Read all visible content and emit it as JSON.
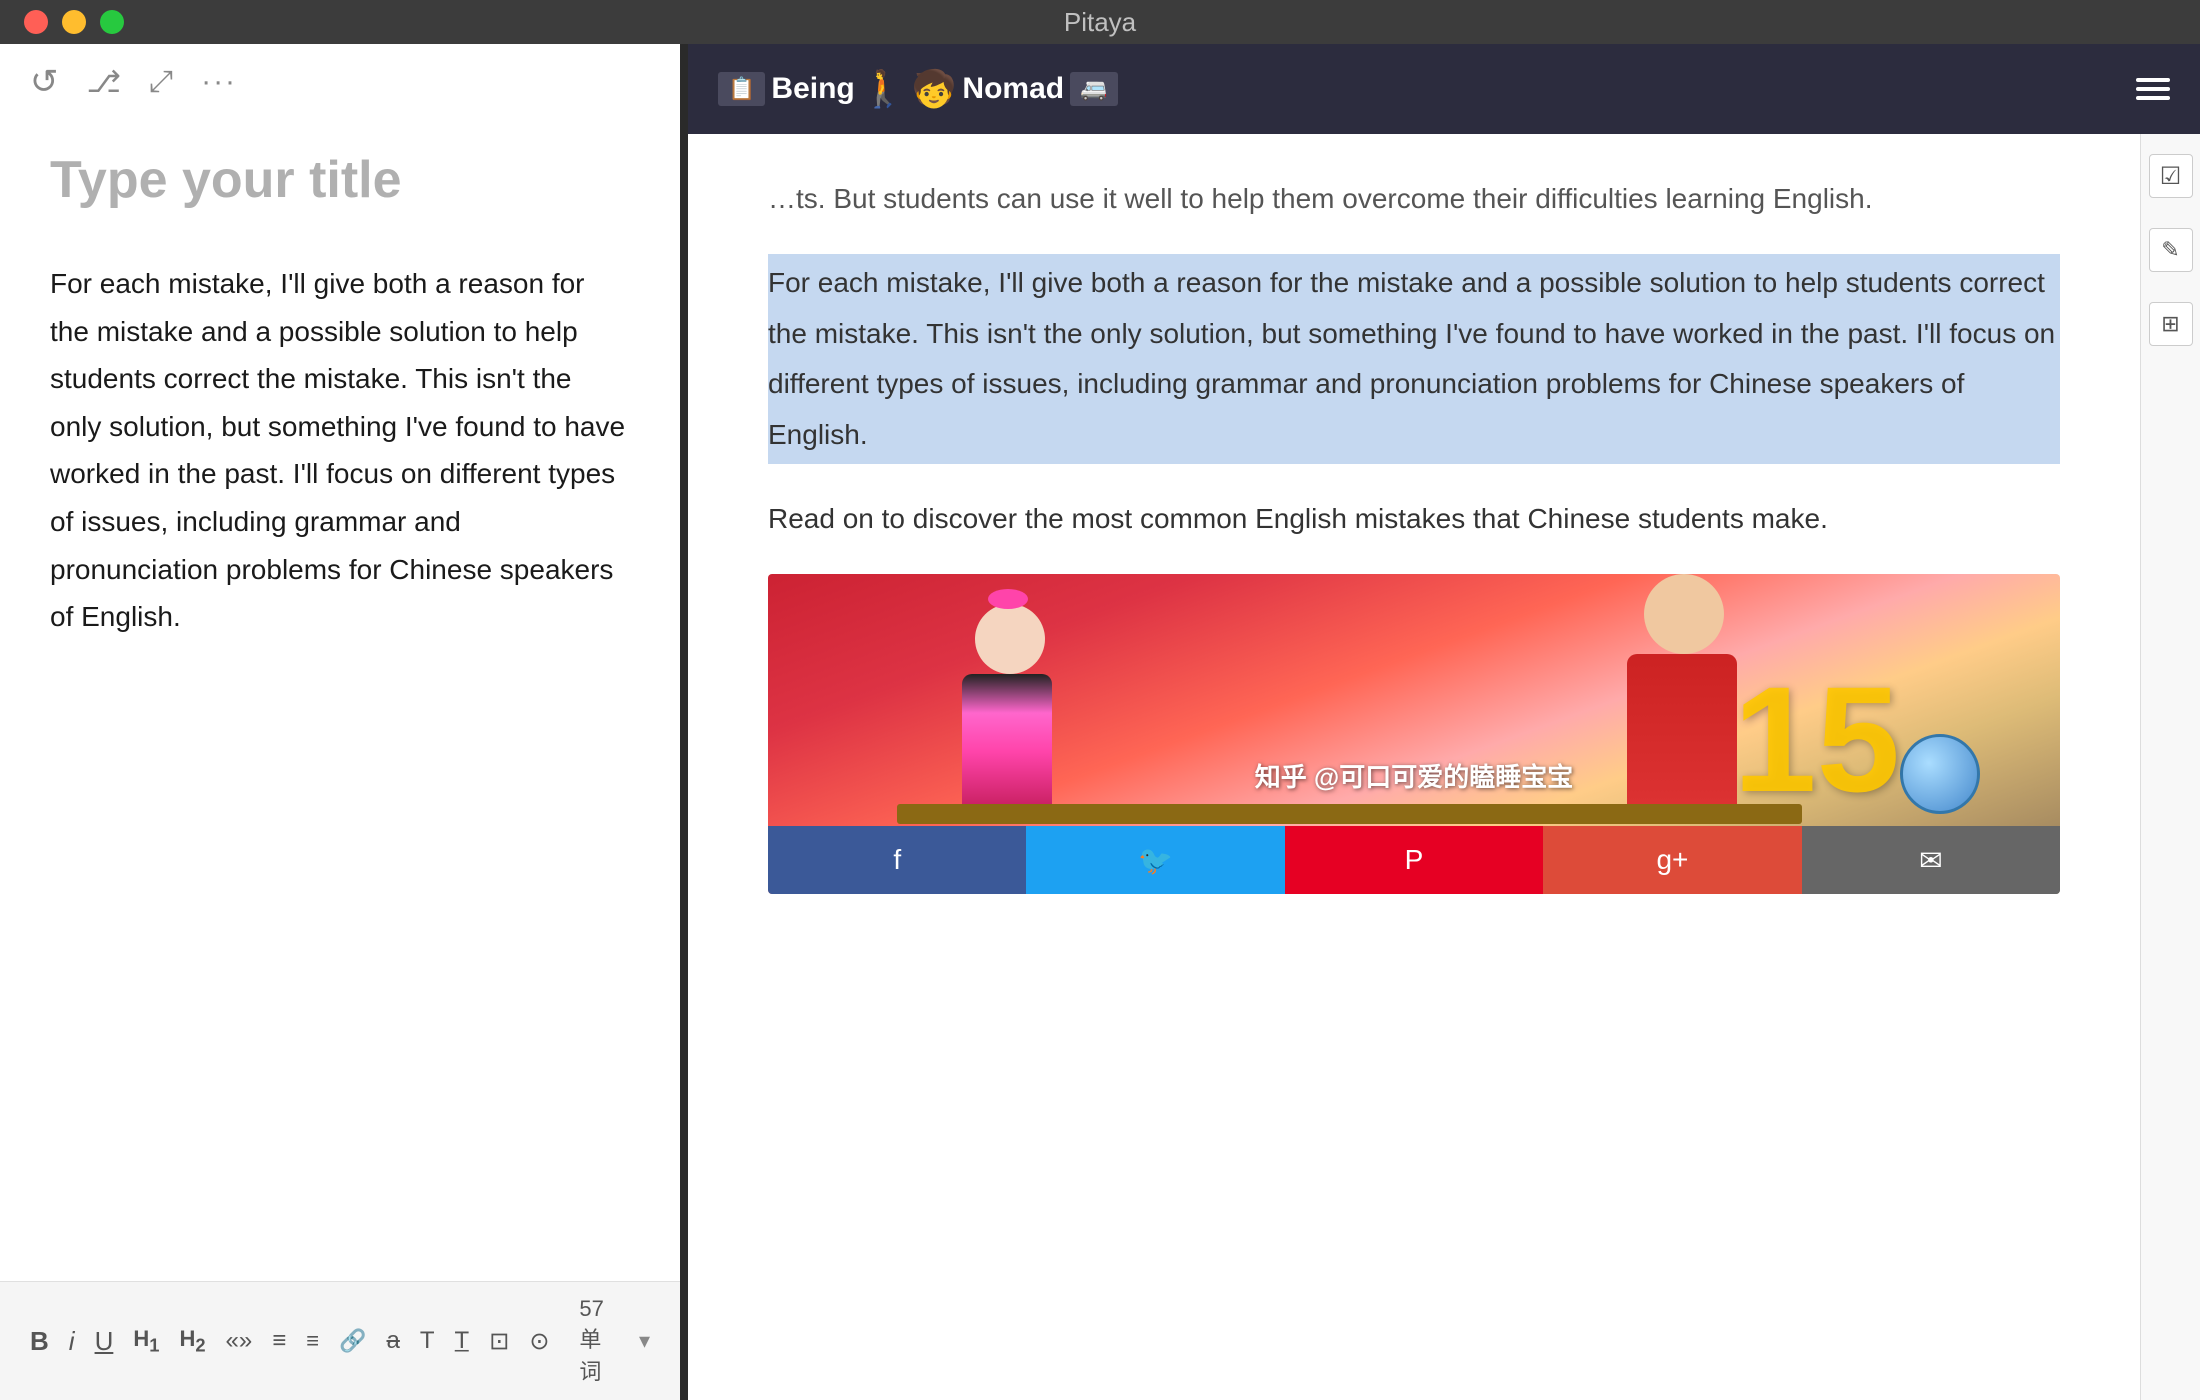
{
  "window": {
    "title": "Pitaya",
    "traffic_lights": [
      "red",
      "yellow",
      "green"
    ]
  },
  "editor": {
    "title_placeholder": "Type your title",
    "body_text": "For each mistake, I'll give both a reason for the mistake and a possible solution to help students correct the mistake. This isn't the only solution, but something I've found to have worked in the past. I'll focus on different types of issues, including grammar and pronunciation problems for Chinese speakers of English.",
    "toolbar_top": {
      "refresh_icon": "↺",
      "share_icon": "⤢",
      "expand_icon": "⤡",
      "more_icon": "···"
    },
    "toolbar_bottom": {
      "bold_label": "B",
      "italic_label": "i",
      "underline_label": "U",
      "h1_label": "H₁",
      "h2_label": "H₂",
      "quote_label": "«»",
      "list_label": "≡",
      "link_label": "🔗",
      "strikethrough_label": "S̶",
      "text_label": "T",
      "clear_label": "T̲",
      "image_label": "⊡",
      "time_label": "⊙",
      "word_count": "57 单词",
      "word_count_dropdown": "▾"
    }
  },
  "web": {
    "topbar": {
      "logo_left_icon": "📋",
      "logo_text_part1": "Being",
      "logo_person": "👤",
      "logo_text_part2": "Nomad",
      "logo_right_icon": "🚐",
      "hamburger_label": "menu"
    },
    "content": {
      "partial_text_top": "…ts. But students can use it well to help them overcome their difficulties learning English.",
      "highlighted_paragraph": "For each mistake, I'll give both a reason for the mistake and a possible solution to help students correct the mistake. This isn't the only solution, but something I've found to have worked in the past. I'll focus on different types of issues, including grammar and pronunciation problems for Chinese speakers of English.",
      "read_on_text": "Read on to discover the most common English mistakes that Chinese students make.",
      "image_watermark": "知乎 @可口可爱的瞌睡宝宝",
      "image_number": "15",
      "social_icons": {
        "facebook": "f",
        "twitter": "t",
        "pinterest": "P",
        "googleplus": "g+",
        "email": "✉"
      }
    },
    "right_sidebar": {
      "checkbox_icon": "☑",
      "edit_icon": "✎",
      "settings_icon": "⊞"
    }
  }
}
